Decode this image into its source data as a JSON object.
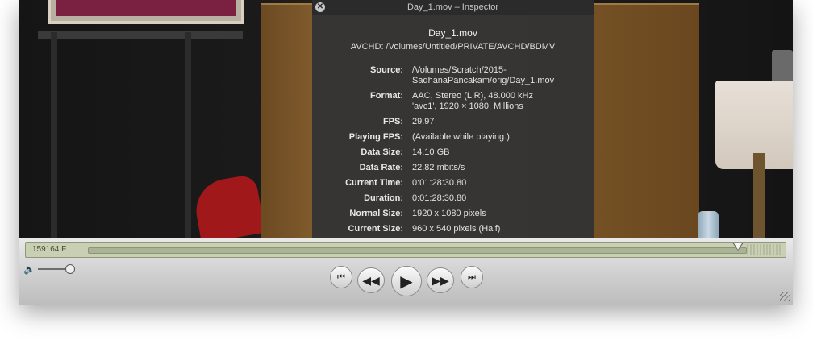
{
  "inspector": {
    "title": "Day_1.mov – Inspector",
    "filename": "Day_1.mov",
    "codec_path": "AVCHD: /Volumes/Untitled/PRIVATE/AVCHD/BDMV",
    "rows": [
      {
        "label": "Source:",
        "lines": [
          "/Volumes/Scratch/2015-",
          "SadhanaPancakam/orig/Day_1.mov"
        ]
      },
      {
        "label": "Format:",
        "lines": [
          "AAC, Stereo (L R), 48.000 kHz",
          "'avc1', 1920 × 1080, Millions"
        ]
      },
      {
        "label": "FPS:",
        "lines": [
          "29.97"
        ]
      },
      {
        "label": "Playing FPS:",
        "lines": [
          "(Available while playing.)"
        ]
      },
      {
        "label": "Data Size:",
        "lines": [
          "14.10 GB"
        ]
      },
      {
        "label": "Data Rate:",
        "lines": [
          "22.82 mbits/s"
        ]
      },
      {
        "label": "Current Time:",
        "lines": [
          "0:01:28:30.80"
        ]
      },
      {
        "label": "Duration:",
        "lines": [
          "0:01:28:30.80"
        ]
      },
      {
        "label": "Normal Size:",
        "lines": [
          "1920 x 1080 pixels"
        ]
      },
      {
        "label": "Current Size:",
        "lines": [
          "960 x 540 pixels (Half)"
        ]
      }
    ]
  },
  "controller": {
    "frame_counter": "159164 F",
    "playback_position": 1.0,
    "volume_level": 1.0,
    "icons": {
      "volume": "speaker-icon",
      "start": "go-to-start-icon",
      "rewind": "rewind-icon",
      "play": "play-icon",
      "forward": "fast-forward-icon",
      "end": "go-to-end-icon"
    }
  }
}
